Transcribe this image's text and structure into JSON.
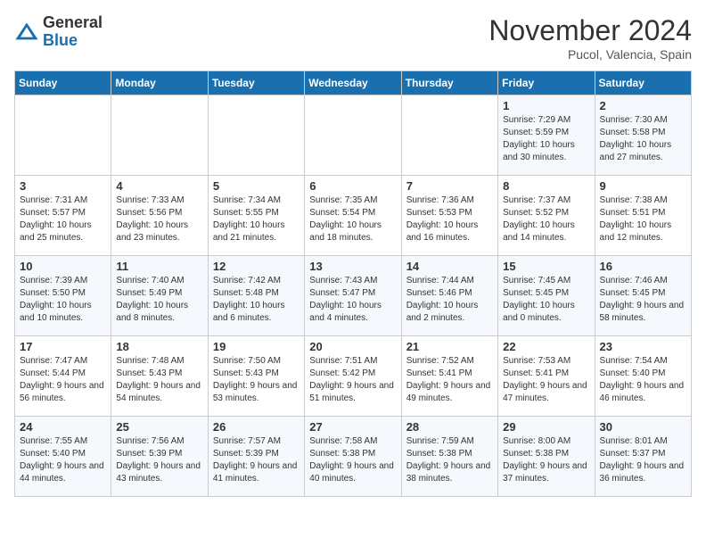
{
  "logo": {
    "general": "General",
    "blue": "Blue"
  },
  "title": "November 2024",
  "subtitle": "Pucol, Valencia, Spain",
  "days_of_week": [
    "Sunday",
    "Monday",
    "Tuesday",
    "Wednesday",
    "Thursday",
    "Friday",
    "Saturday"
  ],
  "weeks": [
    [
      {
        "day": "",
        "info": ""
      },
      {
        "day": "",
        "info": ""
      },
      {
        "day": "",
        "info": ""
      },
      {
        "day": "",
        "info": ""
      },
      {
        "day": "",
        "info": ""
      },
      {
        "day": "1",
        "info": "Sunrise: 7:29 AM\nSunset: 5:59 PM\nDaylight: 10 hours and 30 minutes."
      },
      {
        "day": "2",
        "info": "Sunrise: 7:30 AM\nSunset: 5:58 PM\nDaylight: 10 hours and 27 minutes."
      }
    ],
    [
      {
        "day": "3",
        "info": "Sunrise: 7:31 AM\nSunset: 5:57 PM\nDaylight: 10 hours and 25 minutes."
      },
      {
        "day": "4",
        "info": "Sunrise: 7:33 AM\nSunset: 5:56 PM\nDaylight: 10 hours and 23 minutes."
      },
      {
        "day": "5",
        "info": "Sunrise: 7:34 AM\nSunset: 5:55 PM\nDaylight: 10 hours and 21 minutes."
      },
      {
        "day": "6",
        "info": "Sunrise: 7:35 AM\nSunset: 5:54 PM\nDaylight: 10 hours and 18 minutes."
      },
      {
        "day": "7",
        "info": "Sunrise: 7:36 AM\nSunset: 5:53 PM\nDaylight: 10 hours and 16 minutes."
      },
      {
        "day": "8",
        "info": "Sunrise: 7:37 AM\nSunset: 5:52 PM\nDaylight: 10 hours and 14 minutes."
      },
      {
        "day": "9",
        "info": "Sunrise: 7:38 AM\nSunset: 5:51 PM\nDaylight: 10 hours and 12 minutes."
      }
    ],
    [
      {
        "day": "10",
        "info": "Sunrise: 7:39 AM\nSunset: 5:50 PM\nDaylight: 10 hours and 10 minutes."
      },
      {
        "day": "11",
        "info": "Sunrise: 7:40 AM\nSunset: 5:49 PM\nDaylight: 10 hours and 8 minutes."
      },
      {
        "day": "12",
        "info": "Sunrise: 7:42 AM\nSunset: 5:48 PM\nDaylight: 10 hours and 6 minutes."
      },
      {
        "day": "13",
        "info": "Sunrise: 7:43 AM\nSunset: 5:47 PM\nDaylight: 10 hours and 4 minutes."
      },
      {
        "day": "14",
        "info": "Sunrise: 7:44 AM\nSunset: 5:46 PM\nDaylight: 10 hours and 2 minutes."
      },
      {
        "day": "15",
        "info": "Sunrise: 7:45 AM\nSunset: 5:45 PM\nDaylight: 10 hours and 0 minutes."
      },
      {
        "day": "16",
        "info": "Sunrise: 7:46 AM\nSunset: 5:45 PM\nDaylight: 9 hours and 58 minutes."
      }
    ],
    [
      {
        "day": "17",
        "info": "Sunrise: 7:47 AM\nSunset: 5:44 PM\nDaylight: 9 hours and 56 minutes."
      },
      {
        "day": "18",
        "info": "Sunrise: 7:48 AM\nSunset: 5:43 PM\nDaylight: 9 hours and 54 minutes."
      },
      {
        "day": "19",
        "info": "Sunrise: 7:50 AM\nSunset: 5:43 PM\nDaylight: 9 hours and 53 minutes."
      },
      {
        "day": "20",
        "info": "Sunrise: 7:51 AM\nSunset: 5:42 PM\nDaylight: 9 hours and 51 minutes."
      },
      {
        "day": "21",
        "info": "Sunrise: 7:52 AM\nSunset: 5:41 PM\nDaylight: 9 hours and 49 minutes."
      },
      {
        "day": "22",
        "info": "Sunrise: 7:53 AM\nSunset: 5:41 PM\nDaylight: 9 hours and 47 minutes."
      },
      {
        "day": "23",
        "info": "Sunrise: 7:54 AM\nSunset: 5:40 PM\nDaylight: 9 hours and 46 minutes."
      }
    ],
    [
      {
        "day": "24",
        "info": "Sunrise: 7:55 AM\nSunset: 5:40 PM\nDaylight: 9 hours and 44 minutes."
      },
      {
        "day": "25",
        "info": "Sunrise: 7:56 AM\nSunset: 5:39 PM\nDaylight: 9 hours and 43 minutes."
      },
      {
        "day": "26",
        "info": "Sunrise: 7:57 AM\nSunset: 5:39 PM\nDaylight: 9 hours and 41 minutes."
      },
      {
        "day": "27",
        "info": "Sunrise: 7:58 AM\nSunset: 5:38 PM\nDaylight: 9 hours and 40 minutes."
      },
      {
        "day": "28",
        "info": "Sunrise: 7:59 AM\nSunset: 5:38 PM\nDaylight: 9 hours and 38 minutes."
      },
      {
        "day": "29",
        "info": "Sunrise: 8:00 AM\nSunset: 5:38 PM\nDaylight: 9 hours and 37 minutes."
      },
      {
        "day": "30",
        "info": "Sunrise: 8:01 AM\nSunset: 5:37 PM\nDaylight: 9 hours and 36 minutes."
      }
    ]
  ]
}
